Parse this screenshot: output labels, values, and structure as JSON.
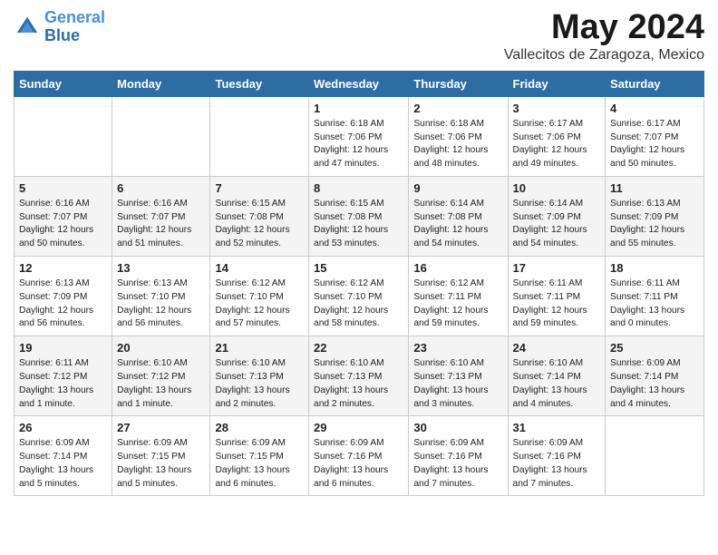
{
  "header": {
    "logo_line1": "General",
    "logo_line2": "Blue",
    "month": "May 2024",
    "location": "Vallecitos de Zaragoza, Mexico"
  },
  "weekdays": [
    "Sunday",
    "Monday",
    "Tuesday",
    "Wednesday",
    "Thursday",
    "Friday",
    "Saturday"
  ],
  "weeks": [
    [
      {
        "day": "",
        "info": ""
      },
      {
        "day": "",
        "info": ""
      },
      {
        "day": "",
        "info": ""
      },
      {
        "day": "1",
        "info": "Sunrise: 6:18 AM\nSunset: 7:06 PM\nDaylight: 12 hours\nand 47 minutes."
      },
      {
        "day": "2",
        "info": "Sunrise: 6:18 AM\nSunset: 7:06 PM\nDaylight: 12 hours\nand 48 minutes."
      },
      {
        "day": "3",
        "info": "Sunrise: 6:17 AM\nSunset: 7:06 PM\nDaylight: 12 hours\nand 49 minutes."
      },
      {
        "day": "4",
        "info": "Sunrise: 6:17 AM\nSunset: 7:07 PM\nDaylight: 12 hours\nand 50 minutes."
      }
    ],
    [
      {
        "day": "5",
        "info": "Sunrise: 6:16 AM\nSunset: 7:07 PM\nDaylight: 12 hours\nand 50 minutes."
      },
      {
        "day": "6",
        "info": "Sunrise: 6:16 AM\nSunset: 7:07 PM\nDaylight: 12 hours\nand 51 minutes."
      },
      {
        "day": "7",
        "info": "Sunrise: 6:15 AM\nSunset: 7:08 PM\nDaylight: 12 hours\nand 52 minutes."
      },
      {
        "day": "8",
        "info": "Sunrise: 6:15 AM\nSunset: 7:08 PM\nDaylight: 12 hours\nand 53 minutes."
      },
      {
        "day": "9",
        "info": "Sunrise: 6:14 AM\nSunset: 7:08 PM\nDaylight: 12 hours\nand 54 minutes."
      },
      {
        "day": "10",
        "info": "Sunrise: 6:14 AM\nSunset: 7:09 PM\nDaylight: 12 hours\nand 54 minutes."
      },
      {
        "day": "11",
        "info": "Sunrise: 6:13 AM\nSunset: 7:09 PM\nDaylight: 12 hours\nand 55 minutes."
      }
    ],
    [
      {
        "day": "12",
        "info": "Sunrise: 6:13 AM\nSunset: 7:09 PM\nDaylight: 12 hours\nand 56 minutes."
      },
      {
        "day": "13",
        "info": "Sunrise: 6:13 AM\nSunset: 7:10 PM\nDaylight: 12 hours\nand 56 minutes."
      },
      {
        "day": "14",
        "info": "Sunrise: 6:12 AM\nSunset: 7:10 PM\nDaylight: 12 hours\nand 57 minutes."
      },
      {
        "day": "15",
        "info": "Sunrise: 6:12 AM\nSunset: 7:10 PM\nDaylight: 12 hours\nand 58 minutes."
      },
      {
        "day": "16",
        "info": "Sunrise: 6:12 AM\nSunset: 7:11 PM\nDaylight: 12 hours\nand 59 minutes."
      },
      {
        "day": "17",
        "info": "Sunrise: 6:11 AM\nSunset: 7:11 PM\nDaylight: 12 hours\nand 59 minutes."
      },
      {
        "day": "18",
        "info": "Sunrise: 6:11 AM\nSunset: 7:11 PM\nDaylight: 13 hours\nand 0 minutes."
      }
    ],
    [
      {
        "day": "19",
        "info": "Sunrise: 6:11 AM\nSunset: 7:12 PM\nDaylight: 13 hours\nand 1 minute."
      },
      {
        "day": "20",
        "info": "Sunrise: 6:10 AM\nSunset: 7:12 PM\nDaylight: 13 hours\nand 1 minute."
      },
      {
        "day": "21",
        "info": "Sunrise: 6:10 AM\nSunset: 7:13 PM\nDaylight: 13 hours\nand 2 minutes."
      },
      {
        "day": "22",
        "info": "Sunrise: 6:10 AM\nSunset: 7:13 PM\nDaylight: 13 hours\nand 2 minutes."
      },
      {
        "day": "23",
        "info": "Sunrise: 6:10 AM\nSunset: 7:13 PM\nDaylight: 13 hours\nand 3 minutes."
      },
      {
        "day": "24",
        "info": "Sunrise: 6:10 AM\nSunset: 7:14 PM\nDaylight: 13 hours\nand 4 minutes."
      },
      {
        "day": "25",
        "info": "Sunrise: 6:09 AM\nSunset: 7:14 PM\nDaylight: 13 hours\nand 4 minutes."
      }
    ],
    [
      {
        "day": "26",
        "info": "Sunrise: 6:09 AM\nSunset: 7:14 PM\nDaylight: 13 hours\nand 5 minutes."
      },
      {
        "day": "27",
        "info": "Sunrise: 6:09 AM\nSunset: 7:15 PM\nDaylight: 13 hours\nand 5 minutes."
      },
      {
        "day": "28",
        "info": "Sunrise: 6:09 AM\nSunset: 7:15 PM\nDaylight: 13 hours\nand 6 minutes."
      },
      {
        "day": "29",
        "info": "Sunrise: 6:09 AM\nSunset: 7:16 PM\nDaylight: 13 hours\nand 6 minutes."
      },
      {
        "day": "30",
        "info": "Sunrise: 6:09 AM\nSunset: 7:16 PM\nDaylight: 13 hours\nand 7 minutes."
      },
      {
        "day": "31",
        "info": "Sunrise: 6:09 AM\nSunset: 7:16 PM\nDaylight: 13 hours\nand 7 minutes."
      },
      {
        "day": "",
        "info": ""
      }
    ]
  ]
}
